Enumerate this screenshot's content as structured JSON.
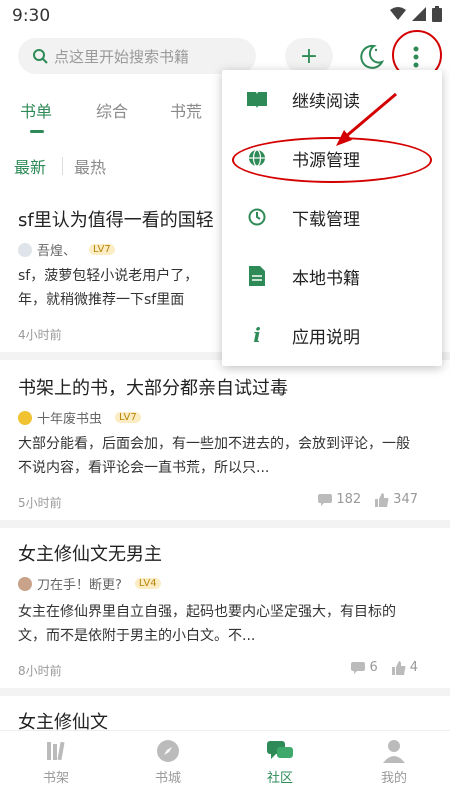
{
  "status_bar": {
    "time": "9:30"
  },
  "search": {
    "placeholder": "点这里开始搜索书籍"
  },
  "tabs": [
    {
      "label": "书单",
      "active": true
    },
    {
      "label": "综合",
      "active": false
    },
    {
      "label": "书荒",
      "active": false
    }
  ],
  "sort": [
    {
      "label": "最新",
      "active": true
    },
    {
      "label": "最热",
      "active": false
    }
  ],
  "posts": [
    {
      "title": "sf里认为值得一看的国轻",
      "author": "吾煌、",
      "level": "LV7",
      "body": "sf，菠萝包轻小说老用户了，\n年，就稍微推荐一下sf里面",
      "time": "4小时前"
    },
    {
      "title": "书架上的书，大部分都亲自试过毒",
      "author": "十年废书虫",
      "level": "LV7",
      "body": "大部分能看，后面会加，有一些加不进去的，会放到评论，一般不说内容，看评论会一直书荒，所以只...",
      "time": "5小时前",
      "comments": "182",
      "likes": "347"
    },
    {
      "title": "女主修仙文无男主",
      "author": "刀在手！断更?",
      "level": "LV4",
      "body": "女主在修仙界里自立自强，起码也要内心坚定强大，有目标的文，而不是依附于男主的小白文。不...",
      "time": "8小时前",
      "comments": "6",
      "likes": "4"
    },
    {
      "title": "女主修仙文"
    }
  ],
  "menu": [
    {
      "label": "继续阅读",
      "icon": "book-icon"
    },
    {
      "label": "书源管理",
      "icon": "globe-icon"
    },
    {
      "label": "下载管理",
      "icon": "clock-icon"
    },
    {
      "label": "本地书籍",
      "icon": "document-icon"
    },
    {
      "label": "应用说明",
      "icon": "info-icon"
    }
  ],
  "bottom_nav": [
    {
      "label": "书架",
      "active": false
    },
    {
      "label": "书城",
      "active": false
    },
    {
      "label": "社区",
      "active": true
    },
    {
      "label": "我的",
      "active": false
    }
  ],
  "colors": {
    "accent": "#2e8b57",
    "annotation": "#d40000"
  }
}
